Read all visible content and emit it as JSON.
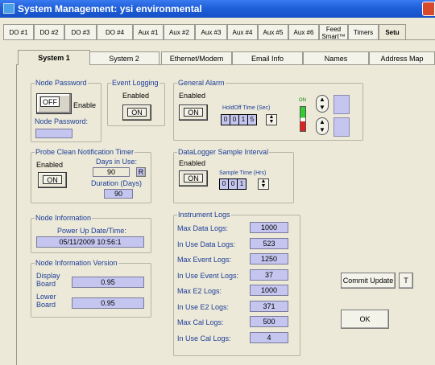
{
  "window": {
    "title": "System Management: ysi environmental"
  },
  "top_tabs": [
    "DO #1",
    "DO #2",
    "DO #3",
    "DO #4",
    "Aux #1",
    "Aux #2",
    "Aux #3",
    "Aux #4",
    "Aux #5",
    "Aux #6",
    "Feed Smart™",
    "Timers",
    "Setu"
  ],
  "sub_tabs": [
    "System 1",
    "System 2",
    "Ethernet/Modem",
    "Email Info",
    "Names",
    "Address Map"
  ],
  "node_password": {
    "legend": "Node Password",
    "off": "OFF",
    "enable": "Enable",
    "label": "Node Password:",
    "value": ""
  },
  "event_logging": {
    "legend": "Event Logging",
    "status": "Enabled",
    "btn": "ON"
  },
  "general_alarm": {
    "legend": "General Alarm",
    "status": "Enabled",
    "btn": "ON",
    "holdoff_label": "HoldOff Time (Sec)",
    "holdoff_digits": [
      "0",
      "0",
      "1",
      "5"
    ],
    "on_label": "ON"
  },
  "probe_clean": {
    "legend": "Probe Clean Notification Timer",
    "status": "Enabled",
    "btn": "ON",
    "days_label": "Days in Use:",
    "days_value": "90",
    "r_btn": "R",
    "duration_label": "Duration (Days)",
    "duration_value": "90"
  },
  "datalogger": {
    "legend": "DataLogger Sample Interval",
    "status": "Enabled",
    "btn": "ON",
    "sample_label": "Sample Time (Hrs)",
    "sample_digits": [
      "0",
      "0",
      "1"
    ]
  },
  "node_info": {
    "legend": "Node Information",
    "power_label": "Power Up Date/Time:",
    "power_value": "05/11/2009 10:56:1"
  },
  "node_version": {
    "legend": "Node Information Version",
    "display_label": "Display Board",
    "display_value": "0.95",
    "lower_label": "Lower Board",
    "lower_value": "0.95"
  },
  "instrument_logs": {
    "legend": "Instrument Logs",
    "rows": [
      {
        "label": "Max Data Logs:",
        "value": "1000"
      },
      {
        "label": "In Use Data Logs:",
        "value": "523"
      },
      {
        "label": "Max Event Logs:",
        "value": "1250"
      },
      {
        "label": "In Use Event Logs:",
        "value": "37"
      },
      {
        "label": "Max E2 Logs:",
        "value": "1000"
      },
      {
        "label": "In Use E2 Logs:",
        "value": "371"
      },
      {
        "label": "Max Cal Logs:",
        "value": "500"
      },
      {
        "label": "In Use Cal Logs:",
        "value": "4"
      }
    ]
  },
  "buttons": {
    "commit": "Commit Update",
    "t": "T",
    "ok": "OK"
  },
  "colors": {
    "titlebar": "#1f5fd8",
    "field": "#c5c6f0",
    "label": "#1c3d98"
  },
  "icons": [
    "app-icon",
    "close-icon",
    "spin-up-down-icon",
    "alarm-indicator-icon"
  ]
}
